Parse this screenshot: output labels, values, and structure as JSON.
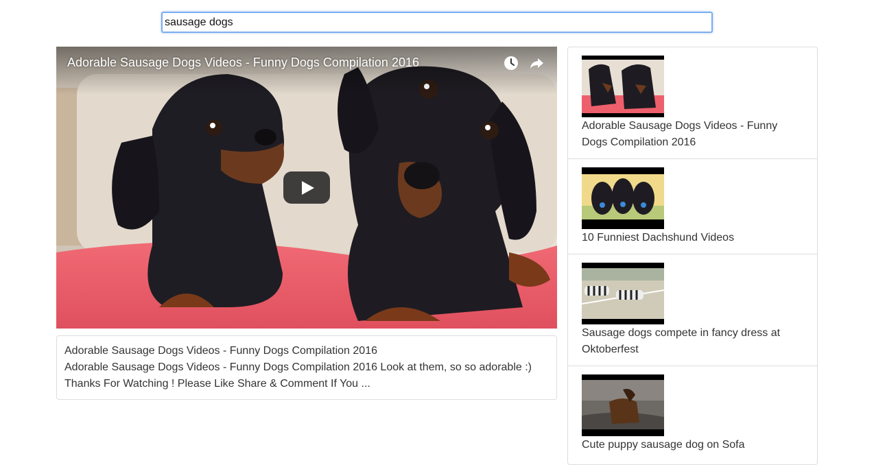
{
  "search": {
    "value": "sausage dogs",
    "placeholder": ""
  },
  "player": {
    "title": "Adorable Sausage Dogs Videos - Funny Dogs Compilation 2016",
    "watch_later_icon": "clock-icon",
    "share_icon": "share-icon",
    "play_icon": "play-icon"
  },
  "details": {
    "title": "Adorable Sausage Dogs Videos - Funny Dogs Compilation 2016",
    "description": "Adorable Sausage Dogs Videos - Funny Dogs Compilation 2016 Look at them, so so adorable :) Thanks For Watching ! Please Like Share & Comment If You ..."
  },
  "video_list": [
    {
      "title": "Adorable Sausage Dogs Videos - Funny Dogs Compilation 2016"
    },
    {
      "title": "10 Funniest Dachshund Videos"
    },
    {
      "title": "Sausage dogs compete in fancy dress at Oktoberfest"
    },
    {
      "title": "Cute puppy sausage dog on Sofa"
    }
  ],
  "colors": {
    "input_focus": "#7aaef0",
    "border": "#dddddd",
    "text": "#333333"
  }
}
